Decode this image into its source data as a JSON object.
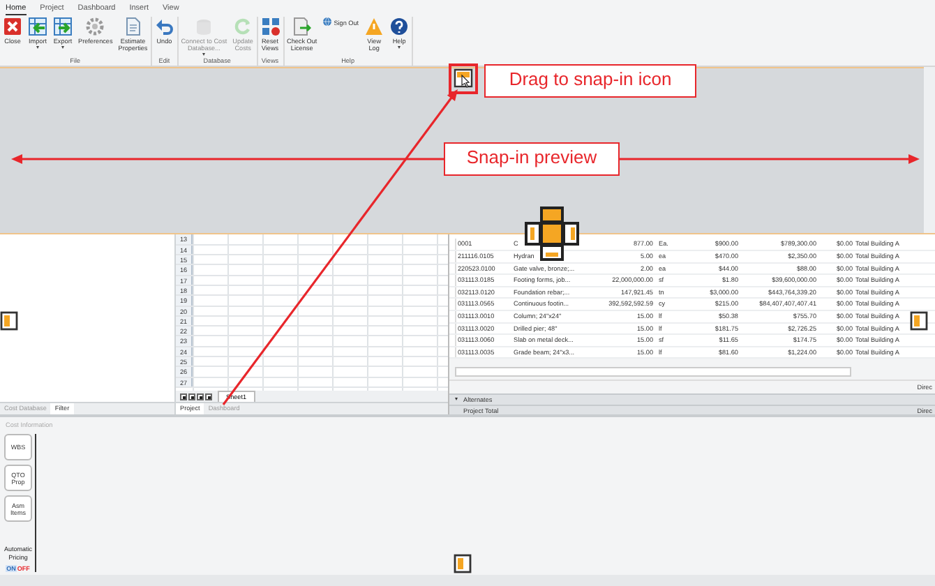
{
  "ribbon": {
    "tabs": [
      {
        "label": "Home",
        "selected": true
      },
      {
        "label": "Project",
        "selected": false
      },
      {
        "label": "Dashboard",
        "selected": false
      },
      {
        "label": "Insert",
        "selected": false
      },
      {
        "label": "View",
        "selected": false
      }
    ],
    "groups": [
      {
        "label": "File",
        "buttons": [
          {
            "label": "Close",
            "disabled": false,
            "dropdown": false
          },
          {
            "label": "Import",
            "disabled": false,
            "dropdown": true
          },
          {
            "label": "Export",
            "disabled": false,
            "dropdown": true
          },
          {
            "label": "Preferences",
            "disabled": false,
            "dropdown": false
          },
          {
            "label": "Estimate\nProperties",
            "disabled": false,
            "dropdown": false
          }
        ]
      },
      {
        "label": "Edit",
        "buttons": [
          {
            "label": "Undo",
            "disabled": false,
            "dropdown": false
          }
        ]
      },
      {
        "label": "Database",
        "buttons": [
          {
            "label": "Connect to Cost\nDatabase...",
            "disabled": true,
            "dropdown": true
          },
          {
            "label": "Update\nCosts",
            "disabled": true,
            "dropdown": false
          }
        ]
      },
      {
        "label": "Views",
        "buttons": [
          {
            "label": "Reset\nViews",
            "disabled": false,
            "dropdown": false
          }
        ]
      },
      {
        "label": "Help",
        "buttons": [
          {
            "label": "Check Out\nLicense",
            "disabled": false,
            "dropdown": false
          },
          {
            "label": "Sign Out",
            "disabled": false,
            "dropdown": false
          },
          {
            "label": "View\nLog",
            "disabled": false,
            "dropdown": false
          },
          {
            "label": "Help",
            "disabled": false,
            "dropdown": true
          }
        ]
      }
    ]
  },
  "annotations": [
    {
      "text": "Drag to snap-in icon"
    },
    {
      "text": "Snap-in preview"
    }
  ],
  "left_panel": {
    "tabs": [
      {
        "label": "Cost Database",
        "selected": false
      },
      {
        "label": "Filter",
        "selected": true
      }
    ]
  },
  "sheet": {
    "row_numbers": [
      "13",
      "14",
      "15",
      "16",
      "17",
      "18",
      "19",
      "20",
      "21",
      "22",
      "23",
      "24",
      "25",
      "26",
      "27"
    ],
    "sheet_tab": "Sheet1",
    "tabs": [
      {
        "label": "Project",
        "selected": true
      },
      {
        "label": "Dashboard",
        "selected": false
      }
    ]
  },
  "cost_table": {
    "rows": [
      [
        "0001",
        "C",
        "877.00",
        "Ea.",
        "$900.00",
        "$789,300.00",
        "$0.00",
        "Total Building A"
      ],
      [
        "211116.0105",
        "Hydran",
        "5.00",
        "ea",
        "$470.00",
        "$2,350.00",
        "$0.00",
        "Total Building A"
      ],
      [
        "220523.0100",
        "Gate valve, bronze;...",
        "2.00",
        "ea",
        "$44.00",
        "$88.00",
        "$0.00",
        "Total Building A"
      ],
      [
        "031113.0185",
        "Footing forms, job...",
        "22,000,000.00",
        "sf",
        "$1.80",
        "$39,600,000.00",
        "$0.00",
        "Total Building A"
      ],
      [
        "032113.0120",
        "Foundation rebar;...",
        "147,921.45",
        "tn",
        "$3,000.00",
        "$443,764,339.20",
        "$0.00",
        "Total Building A"
      ],
      [
        "031113.0565",
        "Continuous footin...",
        "392,592,592.59",
        "cy",
        "$215.00",
        "$84,407,407,407.41",
        "$0.00",
        "Total Building A"
      ],
      [
        "031113.0010",
        "Column; 24\"x24\"",
        "15.00",
        "lf",
        "$50.38",
        "$755.70",
        "$0.00",
        "Total Building A"
      ],
      [
        "031113.0020",
        "Drilled pier; 48\"",
        "15.00",
        "lf",
        "$181.75",
        "$2,726.25",
        "$0.00",
        "Total Building A"
      ],
      [
        "031113.0060",
        "Slab on metal deck...",
        "15.00",
        "sf",
        "$11.65",
        "$174.75",
        "$0.00",
        "Total Building A"
      ],
      [
        "031113.0035",
        "Grade beam; 24\"x3...",
        "15.00",
        "lf",
        "$81.60",
        "$1,224.00",
        "$0.00",
        "Total Building A"
      ]
    ],
    "footer": "Direc"
  },
  "alternates": {
    "label": "Alternates"
  },
  "project_total": {
    "label": "Project Total",
    "value": "Direc"
  },
  "cost_information": {
    "title": "Cost Information",
    "buttons": [
      "WBS",
      "QTO\nProp",
      "Asm\nItems"
    ],
    "automatic_pricing": {
      "label": "Automatic\nPricing",
      "on_label": "ON",
      "off_label": "OFF",
      "on": false
    }
  }
}
